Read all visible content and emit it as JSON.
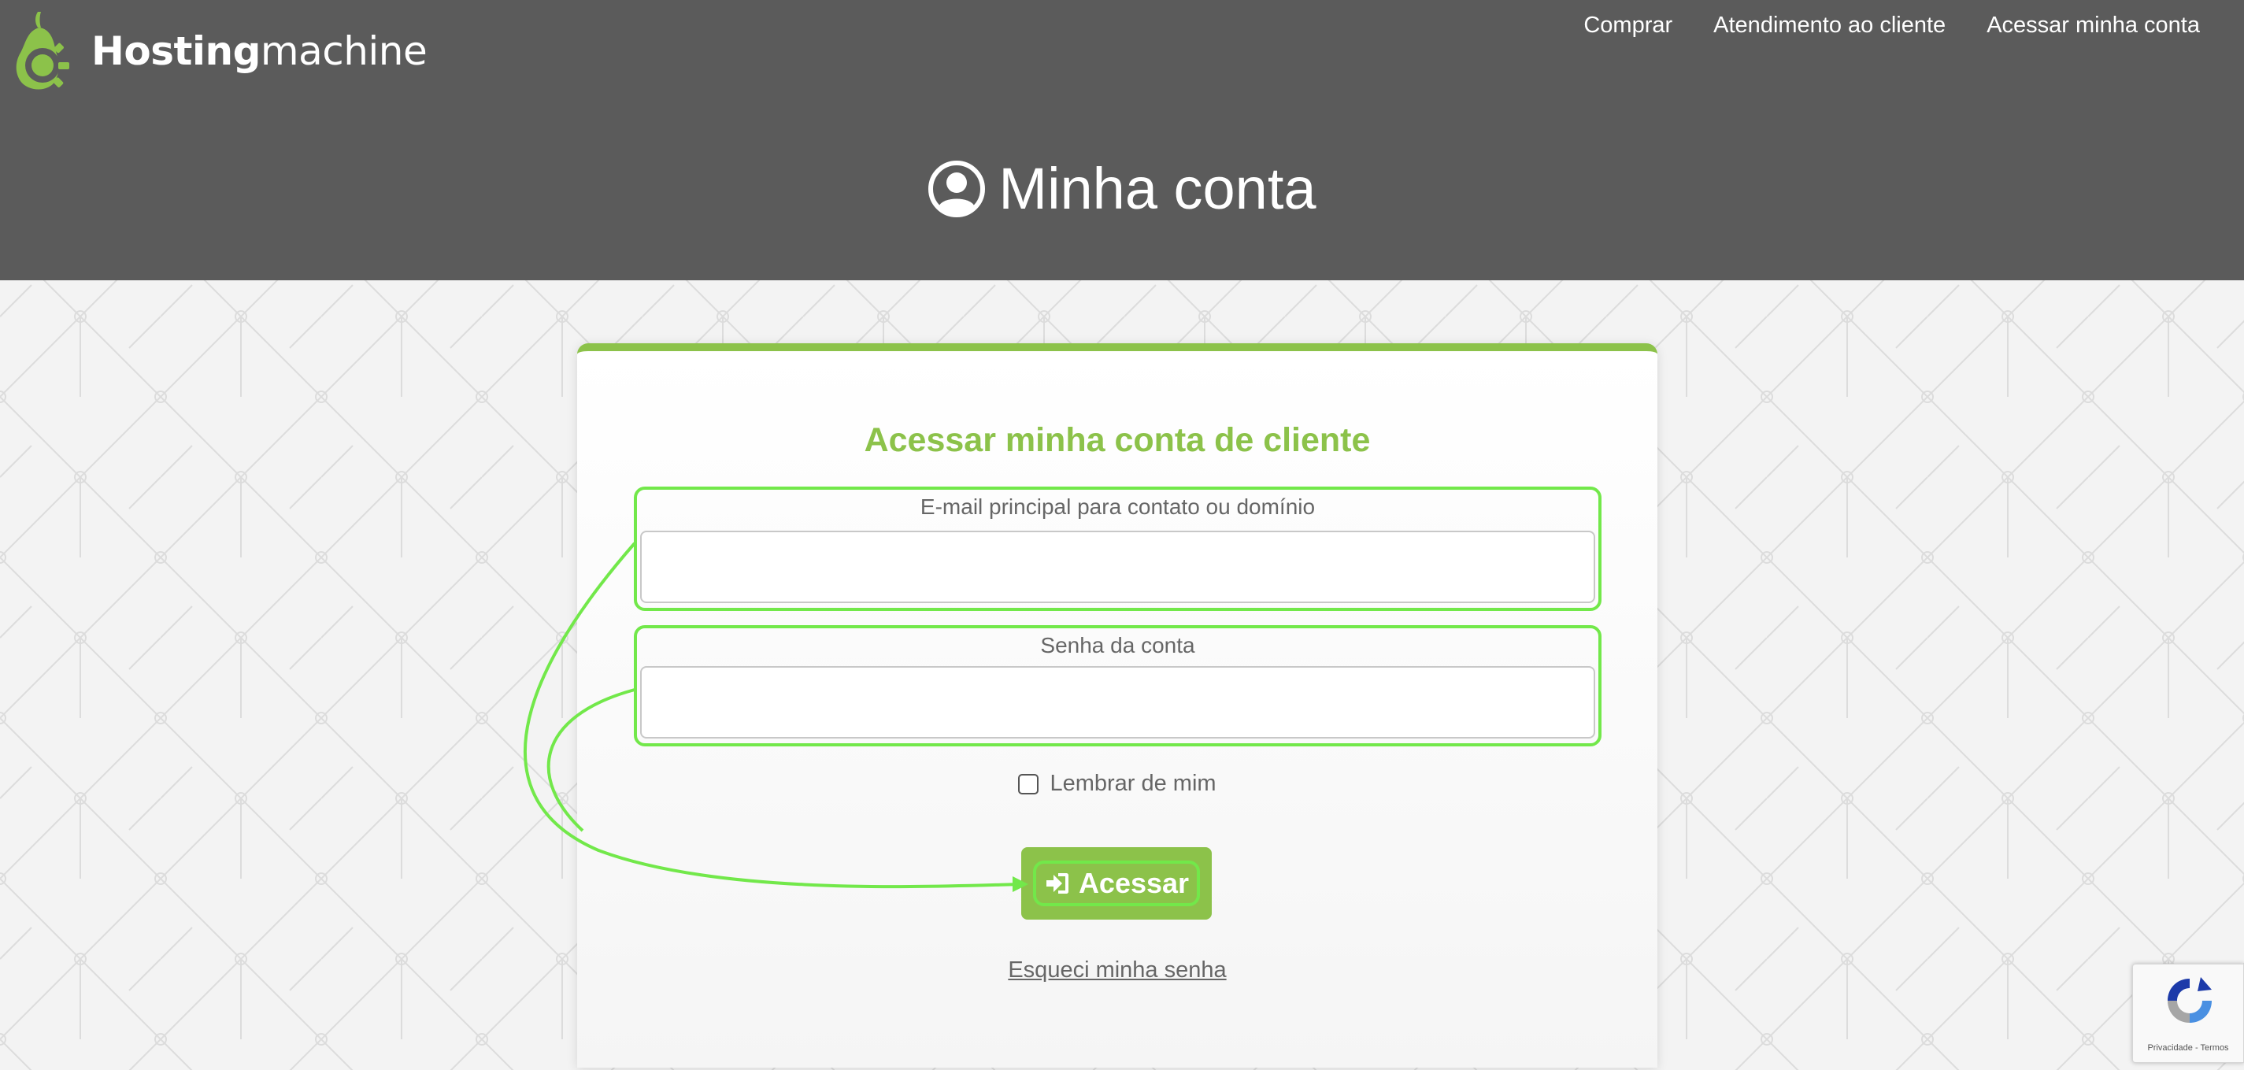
{
  "header": {
    "logo": {
      "bold": "Hosting",
      "regular": "machine"
    },
    "nav": [
      "Comprar",
      "Atendimento ao cliente",
      "Acessar minha conta"
    ],
    "page_title": "Minha conta"
  },
  "form": {
    "title": "Acessar minha conta de cliente",
    "email_label": "E-mail principal para contato ou domínio",
    "email_value": "",
    "password_label": "Senha da conta",
    "password_value": "",
    "remember_label": "Lembrar de mim",
    "remember_checked": false,
    "submit_label": "Acessar",
    "forgot_label": "Esqueci minha senha"
  },
  "recaptcha": {
    "privacy": "Privacidade",
    "separator": " - ",
    "terms": "Termos"
  },
  "colors": {
    "header_bg": "#5b5b5b",
    "brand_green": "#8cc24a",
    "annotation_green": "#72e84a"
  }
}
